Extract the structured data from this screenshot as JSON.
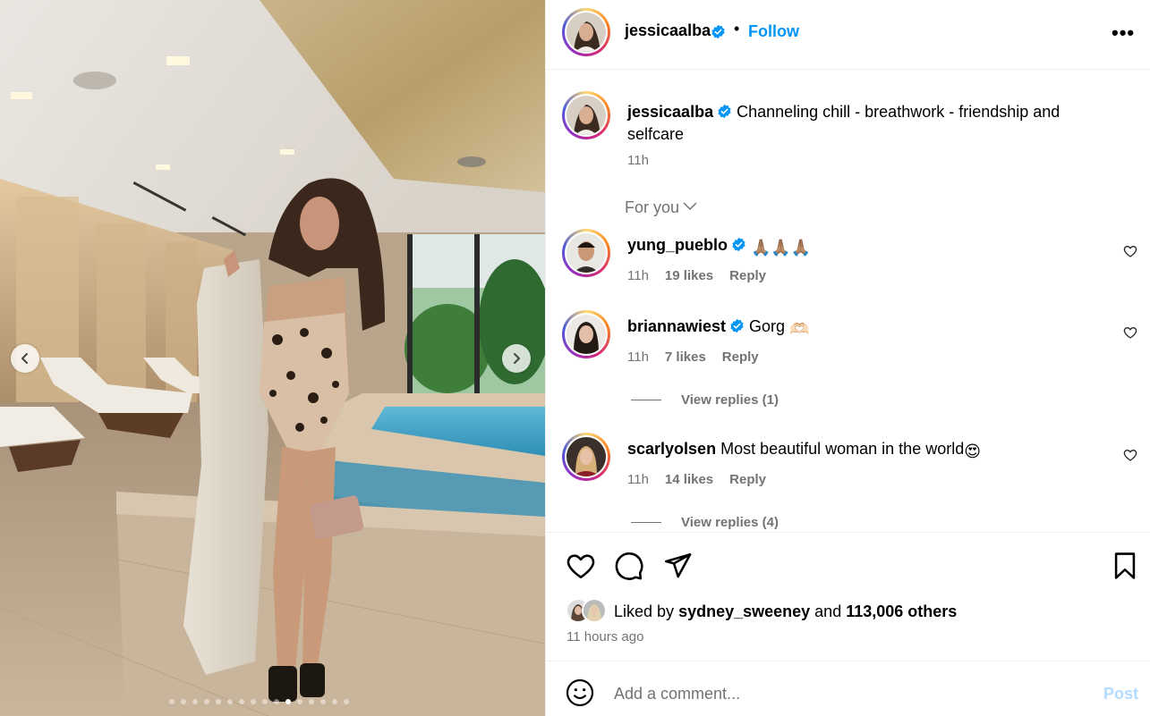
{
  "post": {
    "username": "jessicaalba",
    "follow_label": "Follow",
    "separator": "•",
    "more_label": "•••",
    "caption": "Channeling chill - breathwork - friendship and selfcare",
    "caption_time": "11h",
    "sort_label": "For you",
    "carousel": {
      "slide_count": 16,
      "active_index": 10
    }
  },
  "comments": [
    {
      "username": "yung_pueblo",
      "text": "",
      "emoji": "🙏🏽🙏🏽🙏🏽",
      "time": "11h",
      "likes": "19 likes",
      "reply": "Reply"
    },
    {
      "username": "briannawiest",
      "text": "Gorg",
      "emoji": "🫶🏻",
      "time": "11h",
      "likes": "7 likes",
      "reply": "Reply",
      "view_replies": "View replies (1)"
    },
    {
      "username": "scarlyolsen",
      "text": "Most beautiful woman in the world",
      "emoji": "😍",
      "time": "11h",
      "likes": "14 likes",
      "reply": "Reply",
      "view_replies": "View replies (4)"
    }
  ],
  "likes": {
    "prefix": "Liked by",
    "user": "sydney_sweeney",
    "connector": "and",
    "others": "113,006 others",
    "time_ago": "11 hours ago"
  },
  "composer": {
    "placeholder": "Add a comment...",
    "post_label": "Post"
  },
  "colors": {
    "link": "#0095f6",
    "muted": "#737373",
    "post_disabled": "#b3dbff",
    "verified": "#0095f6"
  }
}
